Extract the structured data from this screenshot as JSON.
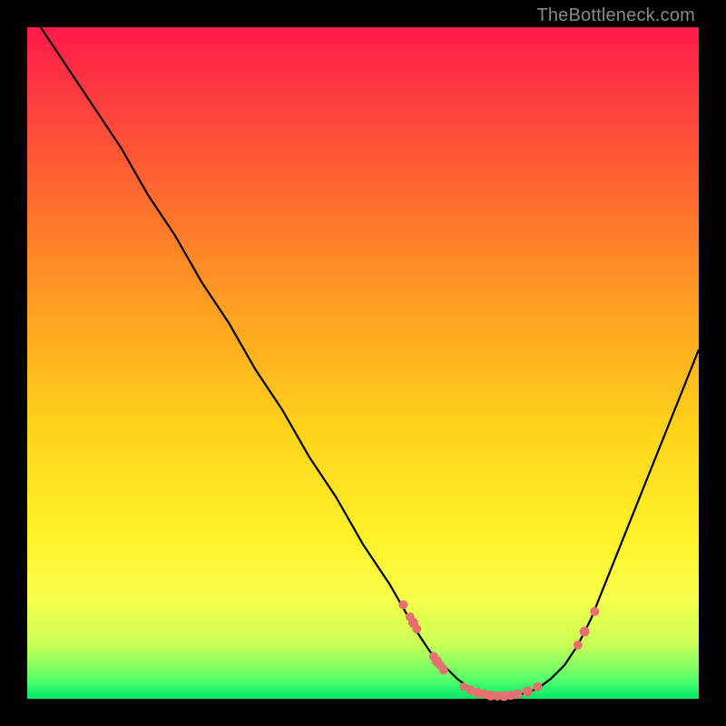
{
  "watermark": "TheBottleneck.com",
  "colors": {
    "curve": "#000000",
    "dot": "#e76f6f",
    "gradient_top": "#ff1a4b",
    "gradient_bottom": "#00e868",
    "frame": "#000000"
  },
  "chart_data": {
    "type": "line",
    "title": "",
    "xlabel": "",
    "ylabel": "",
    "xlim": [
      0,
      100
    ],
    "ylim": [
      0,
      100
    ],
    "annotations": [],
    "series": [
      {
        "name": "bottleneck-curve",
        "x": [
          2,
          6,
          10,
          14,
          18,
          22,
          26,
          30,
          34,
          38,
          42,
          46,
          50,
          54,
          58,
          60,
          62,
          64,
          66,
          68,
          70,
          72,
          74,
          76,
          78,
          80,
          82,
          84,
          86,
          88,
          92,
          96,
          100
        ],
        "y": [
          100,
          94,
          88,
          82,
          75,
          69,
          62,
          56,
          49,
          43,
          36,
          30,
          23,
          17,
          10,
          7,
          5,
          3,
          1.5,
          0.8,
          0.4,
          0.4,
          0.8,
          1.5,
          3,
          5,
          8,
          12,
          17,
          22,
          32,
          42,
          52
        ]
      }
    ],
    "markers": [
      {
        "x": 56.0,
        "y": 14.0,
        "r": 1.0
      },
      {
        "x": 57.0,
        "y": 12.2,
        "r": 1.0
      },
      {
        "x": 57.5,
        "y": 11.3,
        "r": 1.1
      },
      {
        "x": 58.0,
        "y": 10.4,
        "r": 1.0
      },
      {
        "x": 60.5,
        "y": 6.3,
        "r": 1.0
      },
      {
        "x": 61.0,
        "y": 5.6,
        "r": 1.1
      },
      {
        "x": 61.5,
        "y": 5.0,
        "r": 1.0
      },
      {
        "x": 62.0,
        "y": 4.3,
        "r": 1.0
      },
      {
        "x": 65.0,
        "y": 1.8,
        "r": 0.9
      },
      {
        "x": 66.0,
        "y": 1.3,
        "r": 1.0
      },
      {
        "x": 67.0,
        "y": 0.9,
        "r": 1.1
      },
      {
        "x": 68.0,
        "y": 0.7,
        "r": 1.0
      },
      {
        "x": 69.0,
        "y": 0.5,
        "r": 1.1
      },
      {
        "x": 70.0,
        "y": 0.4,
        "r": 1.0
      },
      {
        "x": 71.0,
        "y": 0.4,
        "r": 1.1
      },
      {
        "x": 72.0,
        "y": 0.5,
        "r": 1.0
      },
      {
        "x": 73.0,
        "y": 0.7,
        "r": 1.0
      },
      {
        "x": 74.5,
        "y": 1.1,
        "r": 1.1
      },
      {
        "x": 76.0,
        "y": 1.8,
        "r": 1.0
      },
      {
        "x": 82.0,
        "y": 8.0,
        "r": 1.0
      },
      {
        "x": 83.0,
        "y": 10.0,
        "r": 1.1
      },
      {
        "x": 84.5,
        "y": 13.0,
        "r": 1.0
      }
    ]
  }
}
